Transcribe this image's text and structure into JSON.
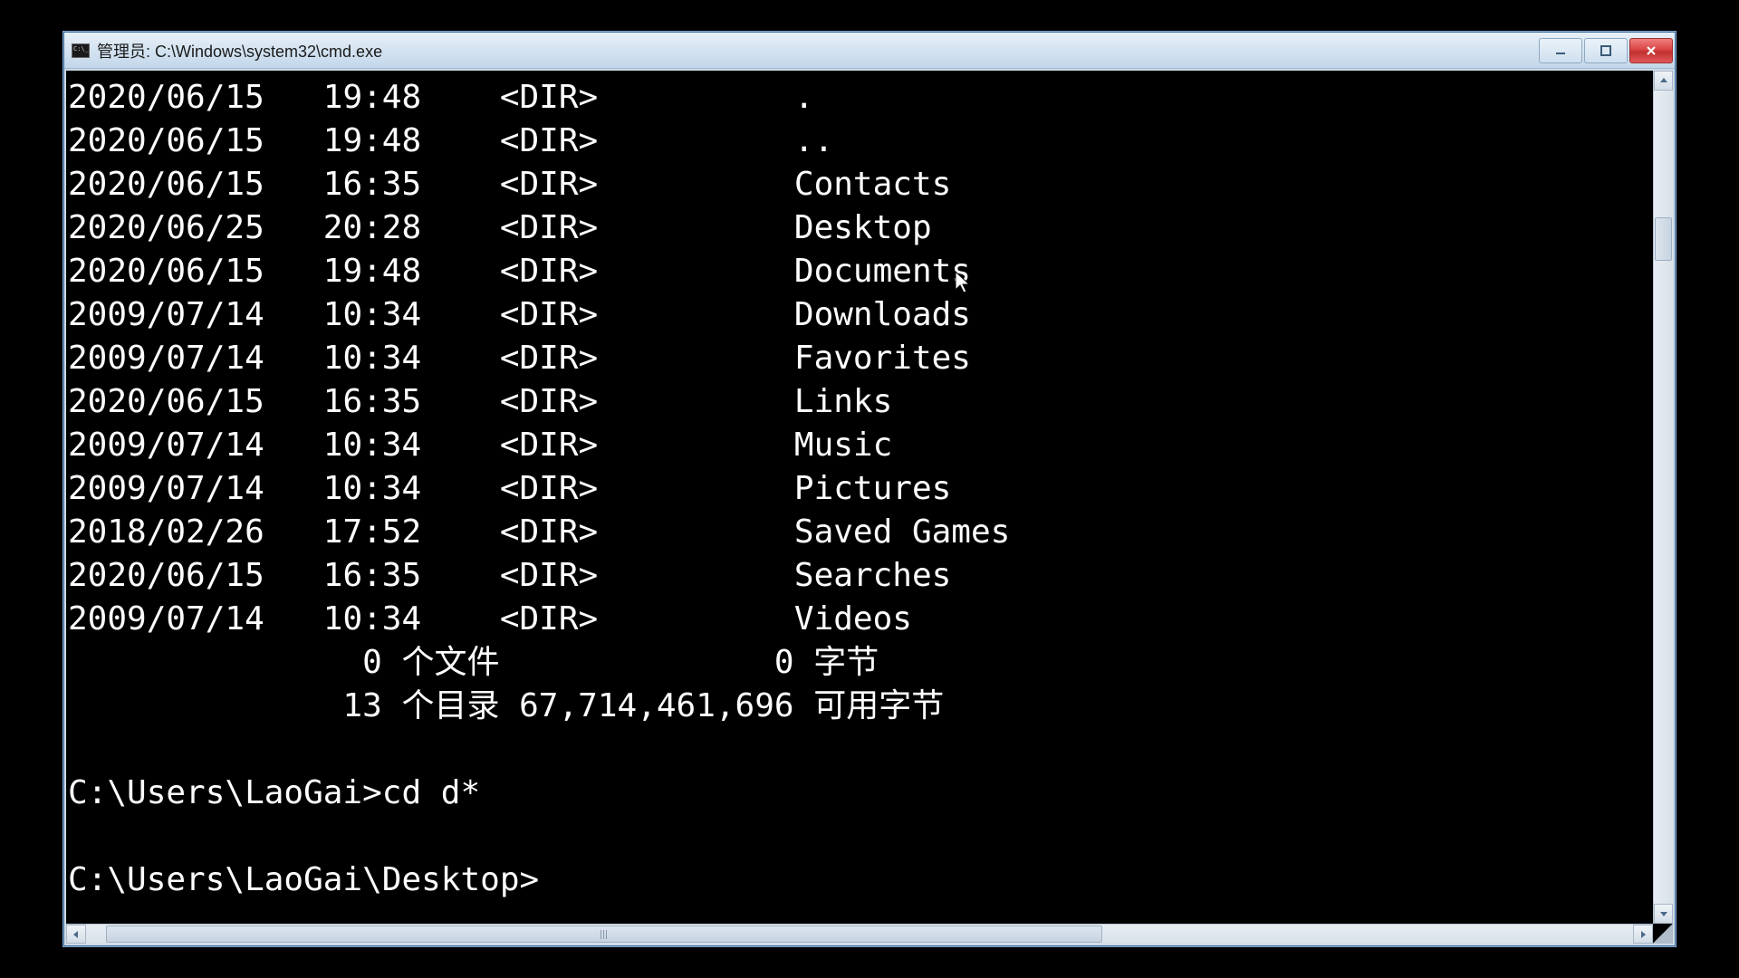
{
  "window": {
    "title": "管理员: C:\\Windows\\system32\\cmd.exe"
  },
  "dir_listing": [
    {
      "date": "2020/06/15",
      "time": "19:48",
      "type": "<DIR>",
      "name": "."
    },
    {
      "date": "2020/06/15",
      "time": "19:48",
      "type": "<DIR>",
      "name": ".."
    },
    {
      "date": "2020/06/15",
      "time": "16:35",
      "type": "<DIR>",
      "name": "Contacts"
    },
    {
      "date": "2020/06/25",
      "time": "20:28",
      "type": "<DIR>",
      "name": "Desktop"
    },
    {
      "date": "2020/06/15",
      "time": "19:48",
      "type": "<DIR>",
      "name": "Documents"
    },
    {
      "date": "2009/07/14",
      "time": "10:34",
      "type": "<DIR>",
      "name": "Downloads"
    },
    {
      "date": "2009/07/14",
      "time": "10:34",
      "type": "<DIR>",
      "name": "Favorites"
    },
    {
      "date": "2020/06/15",
      "time": "16:35",
      "type": "<DIR>",
      "name": "Links"
    },
    {
      "date": "2009/07/14",
      "time": "10:34",
      "type": "<DIR>",
      "name": "Music"
    },
    {
      "date": "2009/07/14",
      "time": "10:34",
      "type": "<DIR>",
      "name": "Pictures"
    },
    {
      "date": "2018/02/26",
      "time": "17:52",
      "type": "<DIR>",
      "name": "Saved Games"
    },
    {
      "date": "2020/06/15",
      "time": "16:35",
      "type": "<DIR>",
      "name": "Searches"
    },
    {
      "date": "2009/07/14",
      "time": "10:34",
      "type": "<DIR>",
      "name": "Videos"
    }
  ],
  "summary": {
    "files_line": "               0 个文件              0 字节",
    "dirs_line": "              13 个目录 67,714,461,696 可用字节"
  },
  "prompts": {
    "line1_path": "C:\\Users\\LaoGai>",
    "line1_cmd": "cd d*",
    "line2_path": "C:\\Users\\LaoGai\\Desktop>"
  }
}
